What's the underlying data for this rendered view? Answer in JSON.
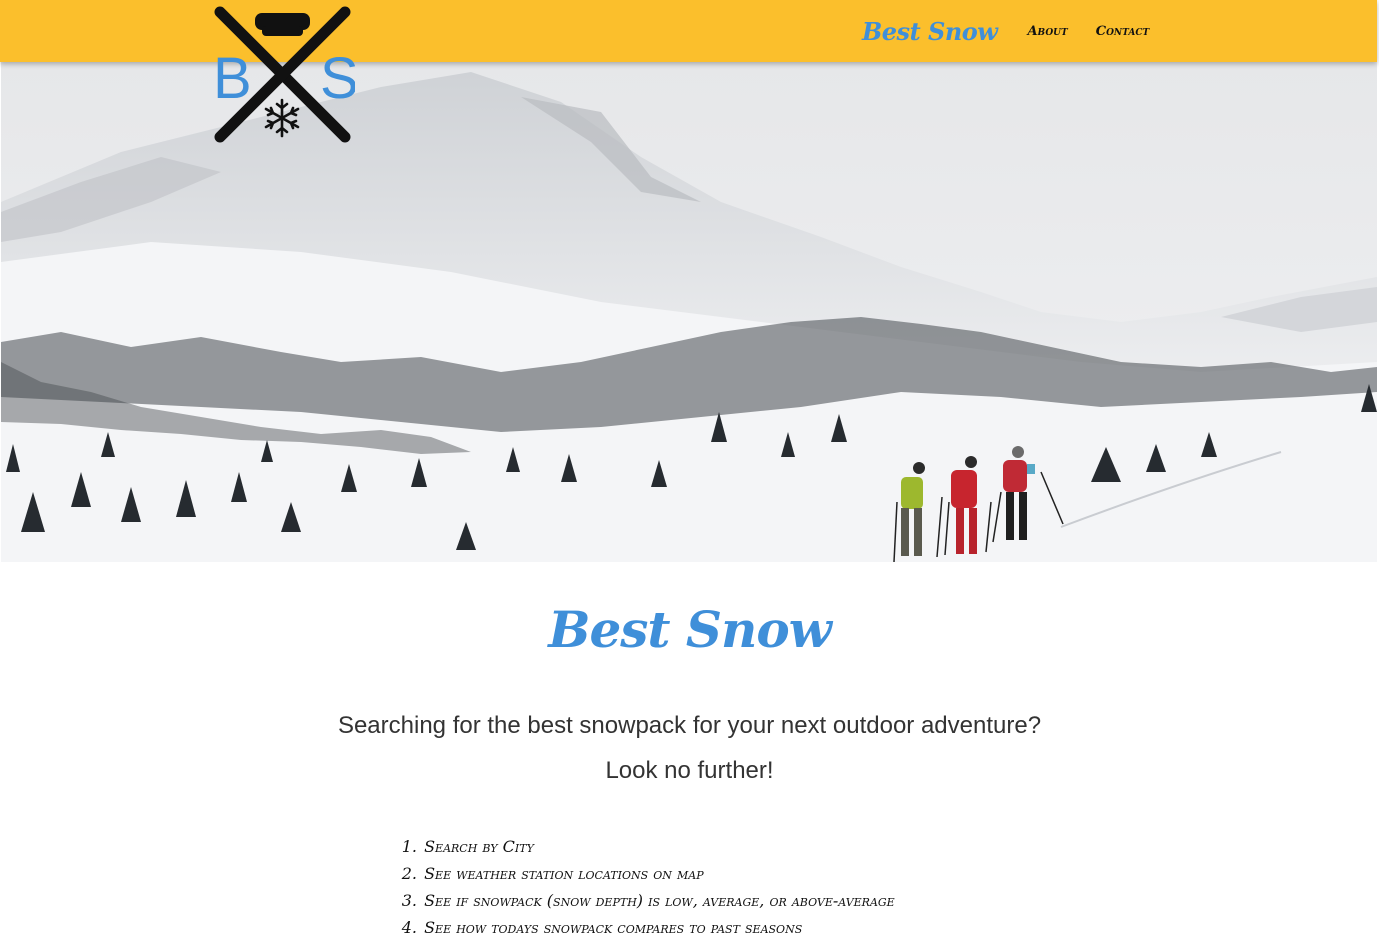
{
  "navbar": {
    "brand": "Best Snow",
    "links": [
      {
        "label": "About"
      },
      {
        "label": "Contact"
      }
    ],
    "background_color": "#fbbf2c",
    "brand_color": "#3f8fd9"
  },
  "logo": {
    "letter_left": "B",
    "letter_right": "S",
    "icon": "crossed-skis-goggles-snowflake-logo",
    "letter_color": "#3f8fd9"
  },
  "hero": {
    "icon": "snowy-mountain-backcountry-skiers-photo"
  },
  "main": {
    "title": "Best Snow",
    "tagline_line1": "Searching for the best snowpack for your next outdoor adventure?",
    "tagline_line2": "Look no further!",
    "features": [
      {
        "number": "1.",
        "text": "Search by City"
      },
      {
        "number": "2.",
        "text": "See weather station locations on map"
      },
      {
        "number": "3.",
        "text": "See if snowpack (snow depth) is low, average, or above-average"
      },
      {
        "number": "4.",
        "text": "See how todays snowpack compares to past seasons"
      }
    ]
  }
}
